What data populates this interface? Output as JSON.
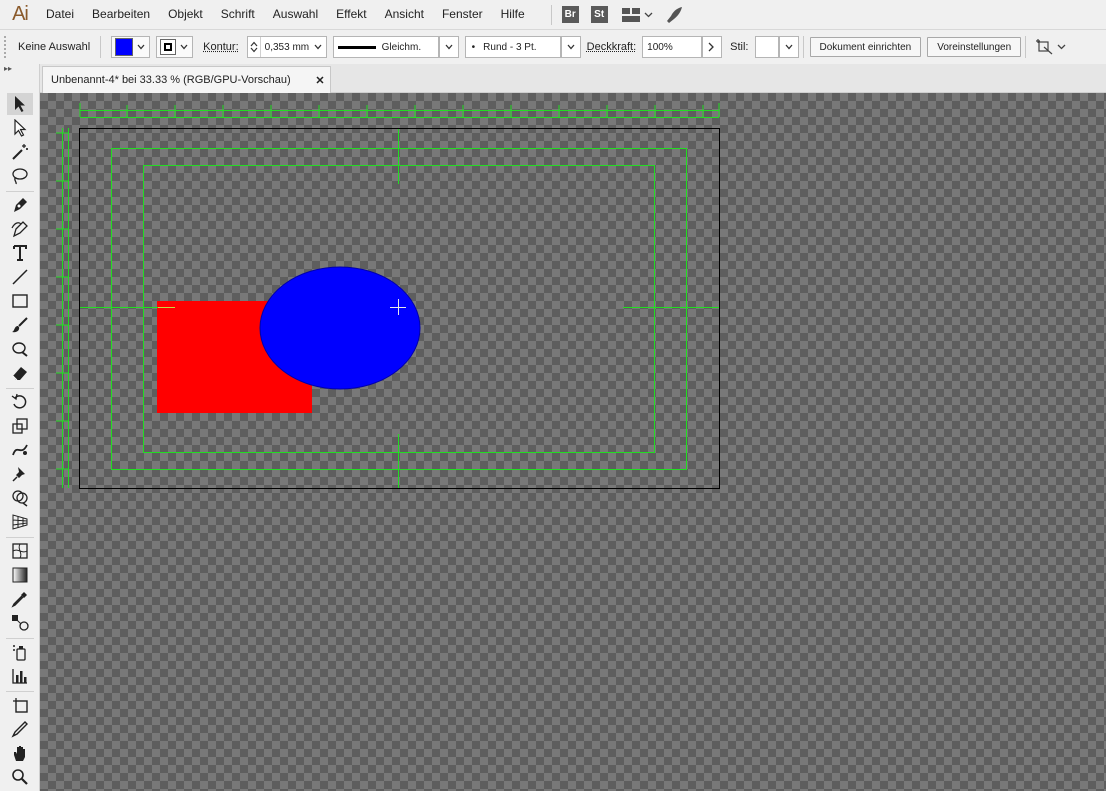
{
  "app": {
    "logo": "Ai"
  },
  "menu": {
    "items": [
      "Datei",
      "Bearbeiten",
      "Objekt",
      "Schrift",
      "Auswahl",
      "Effekt",
      "Ansicht",
      "Fenster",
      "Hilfe"
    ],
    "bridge_badge": "Br",
    "stock_badge": "St"
  },
  "control_bar": {
    "selection_label": "Keine Auswahl",
    "fill_color": "#0000ff",
    "stroke_label": "Kontur:",
    "stroke_weight": "0,353 mm",
    "stroke_profile": "Gleichm.",
    "brush": "Rund - 3 Pt.",
    "opacity_label": "Deckkraft:",
    "opacity_value": "100%",
    "style_label": "Stil:",
    "document_setup_button": "Dokument einrichten",
    "preferences_button": "Voreinstellungen"
  },
  "document_tab": {
    "title": "Unbenannt-4* bei 33.33 % (RGB/GPU-Vorschau)",
    "close": "✕"
  },
  "toolbar": {
    "collapse_glyph": "▸▸",
    "tools": [
      "selection-tool",
      "direct-selection-tool",
      "magic-wand-tool",
      "lasso-tool",
      "pen-tool",
      "curvature-tool",
      "type-tool",
      "line-tool",
      "rectangle-tool",
      "paintbrush-tool",
      "shaper-tool",
      "eraser-tool",
      "rotate-tool",
      "scale-tool",
      "puppet-warp-tool",
      "pin-tool",
      "shape-builder-tool",
      "perspective-grid-tool",
      "mesh-tool",
      "gradient-tool",
      "eyedropper-tool",
      "blend-tool",
      "symbol-sprayer-tool",
      "column-graph-tool",
      "artboard-tool",
      "slice-tool",
      "hand-tool",
      "zoom-tool"
    ]
  },
  "artwork": {
    "rectangle_color": "#ff0000",
    "ellipse_color": "#0000ff",
    "guide_color": "#22dd22",
    "artboard_border_color": "#000000"
  }
}
